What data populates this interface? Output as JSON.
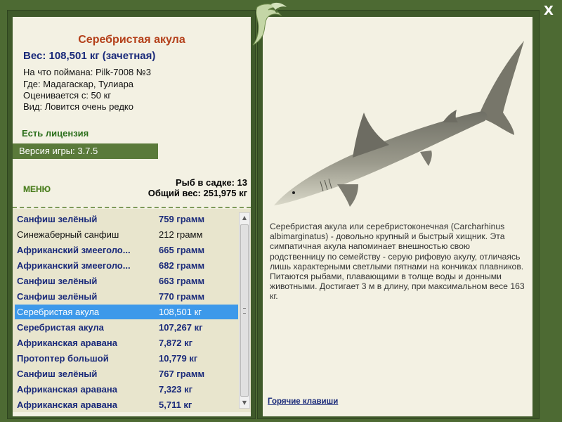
{
  "close_label": "X",
  "fish": {
    "title": "Серебристая акула",
    "weight": "Вес: 108,501 кг (зачетная)",
    "caught_on": "На что поймана: Pilk-7008 №3",
    "location": "Где: Мадагаскар, Тулиара",
    "valued_from": "Оценивается с: 50 кг",
    "rarity": "Вид: Ловится очень редко",
    "description": "Серебристая акула или серебристоконечная (Carcharhinus albimarginatus) - довольно крупный и быстрый хищник. Эта симпатичная акула напоминает внешностью свою родственницу по семейству - серую рифовую акулу, отличаясь лишь характерными светлыми пятнами на кончиках плавников. Питаются рыбами, плавающими в толще воды и донными животными. Достигает 3 м в длину, при максимальном весе 163 кг."
  },
  "license_text": "Есть лицензия",
  "version_text": "Версия игры: 3.7.5",
  "menu_label": "МЕНЮ",
  "cage": {
    "count": "Рыб в садке: 13",
    "total": "Общий вес: 251,975 кг"
  },
  "catch_list": [
    {
      "name": "Санфиш зелёный",
      "weight": "759 грамм",
      "style": "bold"
    },
    {
      "name": "Синежаберный санфиш",
      "weight": "212 грамм",
      "style": "plain"
    },
    {
      "name": "Африканский змееголо...",
      "weight": "665 грамм",
      "style": "bold"
    },
    {
      "name": "Африканский змееголо...",
      "weight": "682 грамм",
      "style": "bold"
    },
    {
      "name": "Санфиш зелёный",
      "weight": "663 грамм",
      "style": "bold"
    },
    {
      "name": "Санфиш зелёный",
      "weight": "770 грамм",
      "style": "bold"
    },
    {
      "name": "Серебристая акула",
      "weight": "108,501 кг",
      "style": "selected"
    },
    {
      "name": "Серебристая акула",
      "weight": "107,267 кг",
      "style": "bold"
    },
    {
      "name": "Африканская аравана",
      "weight": "7,872 кг",
      "style": "bold"
    },
    {
      "name": "Протоптер большой",
      "weight": "10,779 кг",
      "style": "bold"
    },
    {
      "name": "Санфиш зелёный",
      "weight": "767 грамм",
      "style": "bold"
    },
    {
      "name": "Африканская аравана",
      "weight": "7,323 кг",
      "style": "bold"
    },
    {
      "name": "Африканская аравана",
      "weight": "5,711 кг",
      "style": "bold"
    }
  ],
  "hotkeys_label": "Горячие клавиши",
  "icons": {
    "logo": "fish-logo-icon",
    "close": "close-icon",
    "fish_image": "silver-shark-image",
    "scroll_up": "scroll-up-icon",
    "scroll_down": "scroll-down-icon"
  },
  "colors": {
    "frame": "#4d6a33",
    "panel": "#f3f1e3",
    "title": "#b4401a",
    "accent_blue": "#1a2a7a",
    "selected": "#3d99ea",
    "license": "#2a6e1a"
  }
}
